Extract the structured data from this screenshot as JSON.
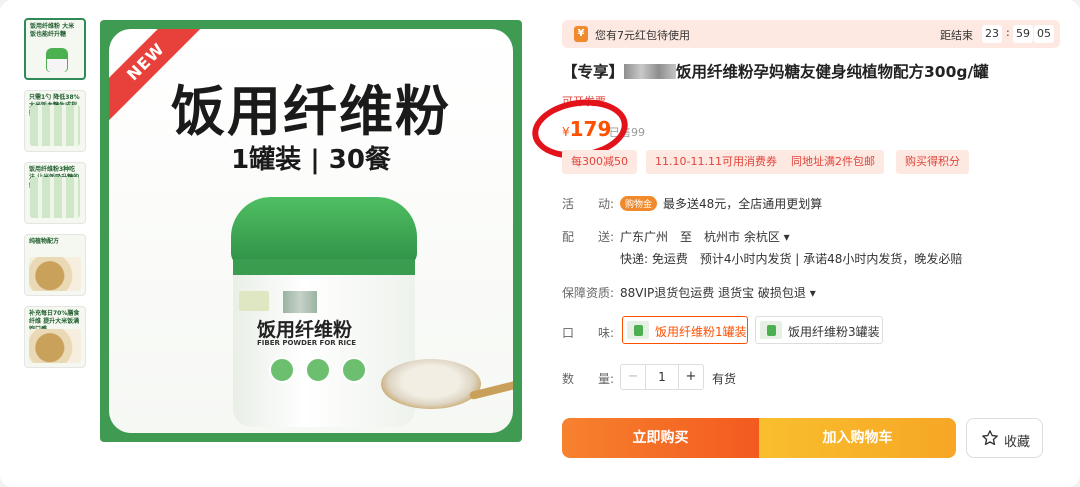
{
  "thumbnails": [
    {
      "caption": "饭用纤维粉 大米饭也能纤升糖"
    },
    {
      "caption": "只需1勺 降低38% 大米饭血糖生成指数"
    },
    {
      "caption": "饭用纤维粉3种吃法 让米饭吸升糖的好搭档"
    },
    {
      "caption": "纯植物配方"
    },
    {
      "caption": "补充每日70%膳食纤维 提升大米饭满饱口感"
    }
  ],
  "main_image": {
    "ribbon": "NEW",
    "title": "饭用纤维粉",
    "subtitle": "1罐装 | 30餐",
    "jar_label": "饭用纤维粉",
    "jar_label_en": "FIBER POWDER FOR RICE"
  },
  "promo": {
    "icon": "¥",
    "text": "您有7元红包待使用",
    "end_label": "距结束",
    "hours": "23",
    "minutes": "59",
    "seconds": "05",
    "sep": ":"
  },
  "product": {
    "title_prefix": "【专享】",
    "title_suffix": "饭用纤维粉孕妈糖友健身纯植物配方300g/罐",
    "open_invoice": "可开发票",
    "currency": "¥",
    "price": "179",
    "sold": "已售99"
  },
  "coupons": [
    "每300减50",
    "11.10-11.11可用消费券",
    "同地址满2件包邮",
    "购买得积分"
  ],
  "activity": {
    "label": "活　　动:",
    "badge": "购物金",
    "text": "最多送48元，全店通用更划算"
  },
  "delivery": {
    "label": "配　　送:",
    "route": "广东广州　至　杭州市 余杭区 ▾",
    "detail": "快递: 免运费　预计4小时内发货 | 承诺48小时内发货，晚发必赔"
  },
  "guarantee": {
    "label": "保障资质:",
    "text": "88VIP退货包运费  退货宝  破损包退 ▾"
  },
  "flavor": {
    "label": "口　　味:",
    "options": [
      "饭用纤维粉1罐装",
      "饭用纤维粉3罐装"
    ]
  },
  "quantity": {
    "label": "数　　量:",
    "minus": "−",
    "value": "1",
    "plus": "+",
    "stock": "有货"
  },
  "actions": {
    "buy": "立即购买",
    "cart": "加入购物车",
    "favorite": "收藏"
  },
  "colors": {
    "accent": "#ff5000",
    "brand_green": "#3f9a52",
    "highlight_circle": "#e3131b"
  }
}
